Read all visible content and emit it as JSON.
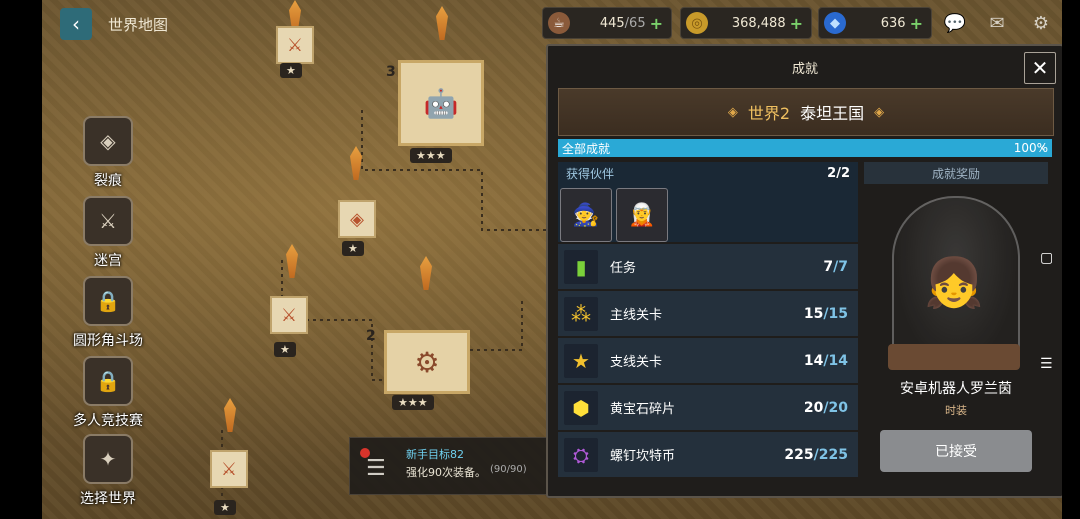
{
  "map": {
    "title": "世界地图",
    "back_icon": "back-arrow-icon",
    "stage_numbers": [
      "3",
      "2"
    ],
    "stars": [
      "★★★",
      "★★★",
      "★",
      "★",
      "★",
      "★"
    ]
  },
  "resources": [
    {
      "icon": "coffee-icon",
      "value": "445",
      "max": "/65",
      "plus": "+"
    },
    {
      "icon": "gold-coin-icon",
      "value": "368,488",
      "plus": "+"
    },
    {
      "icon": "gem-icon",
      "value": "636",
      "plus": "+"
    }
  ],
  "top_icons": [
    "chat-icon",
    "mail-icon",
    "gear-icon"
  ],
  "side_menu": [
    {
      "label": "裂痕",
      "icon": "rift-icon"
    },
    {
      "label": "迷宫",
      "icon": "labyrinth-icon"
    },
    {
      "label": "圆形角斗场",
      "icon": "arena-icon"
    },
    {
      "label": "多人竞技赛",
      "icon": "colosseum-icon"
    },
    {
      "label": "选择世界",
      "icon": "world-select-icon"
    }
  ],
  "mission": {
    "title": "新手目标82",
    "desc": "强化90次装备。",
    "progress": "(90/90)"
  },
  "panel": {
    "title": "成就",
    "close": "✕",
    "world_label": "世界2",
    "world_name": "泰坦王国",
    "all_label": "全部成就",
    "all_pct": "100%",
    "all_fraction": 1.0,
    "partners_label": "获得伙伴",
    "partners_count": "2/2",
    "achievements": [
      {
        "icon": "bookmark-icon",
        "label": "任务",
        "done": "7",
        "total": "/7"
      },
      {
        "icon": "stars-icon",
        "label": "主线关卡",
        "done": "15",
        "total": "/15"
      },
      {
        "icon": "star-icon",
        "label": "支线关卡",
        "done": "14",
        "total": "/14"
      },
      {
        "icon": "gem-shard-icon",
        "label": "黄宝石碎片",
        "done": "20",
        "total": "/20"
      },
      {
        "icon": "bolt-icon",
        "label": "螺钉坎特币",
        "done": "225",
        "total": "/225"
      }
    ],
    "reward_label": "成就奖励",
    "reward_name": "安卓机器人罗兰茵",
    "reward_type": "时装",
    "accepted_label": "已接受"
  }
}
